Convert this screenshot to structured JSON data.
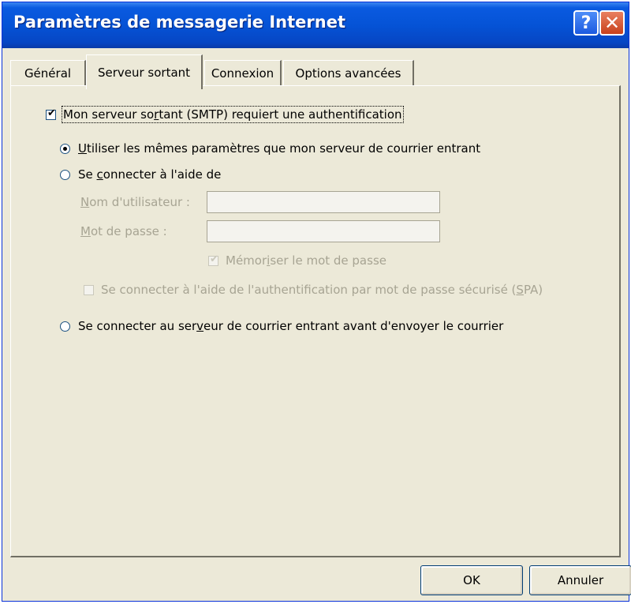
{
  "window": {
    "title": "Paramètres de messagerie Internet",
    "help_label": "?",
    "close_label": "✕"
  },
  "tabs": [
    {
      "label": "Général",
      "active": false
    },
    {
      "label": "Serveur sortant",
      "active": true
    },
    {
      "label": "Connexion",
      "active": false
    },
    {
      "label": "Options avancées",
      "active": false
    }
  ],
  "auth_checkbox": {
    "label_before": "Mon serveur so",
    "label_u": "r",
    "label_after": "tant (SMTP) requiert une authentification",
    "checked": true
  },
  "radio_same_settings": {
    "label_u": "U",
    "label_after": "tiliser les mêmes paramètres que mon serveur de courrier entrant",
    "selected": true
  },
  "radio_connect_with": {
    "label_before": "Se ",
    "label_u": "c",
    "label_after": "onnecter à l'aide de",
    "selected": false
  },
  "username": {
    "label_u": "N",
    "label_after": "om d'utilisateur :",
    "value": ""
  },
  "password": {
    "label_u": "M",
    "label_after": "ot de passe :",
    "value": ""
  },
  "remember_password": {
    "label_before": "Mémor",
    "label_u": "i",
    "label_after": "ser le mot de passe",
    "checked": true,
    "disabled": true
  },
  "spa_checkbox": {
    "label_before": "Se connecter à l'aide de l'authentification par mot de passe sécurisé (",
    "label_u": "S",
    "label_after": "PA)",
    "checked": false,
    "disabled": true
  },
  "radio_incoming_first": {
    "label_before": "Se connecter au ser",
    "label_u": "v",
    "label_after": "eur de courrier entrant avant d'envoyer le courrier",
    "selected": false
  },
  "buttons": {
    "ok": "OK",
    "cancel": "Annuler"
  },
  "colors": {
    "titlebar": "#0553d6",
    "dialog_bg": "#ece9d8",
    "disabled_text": "#a7a493"
  }
}
